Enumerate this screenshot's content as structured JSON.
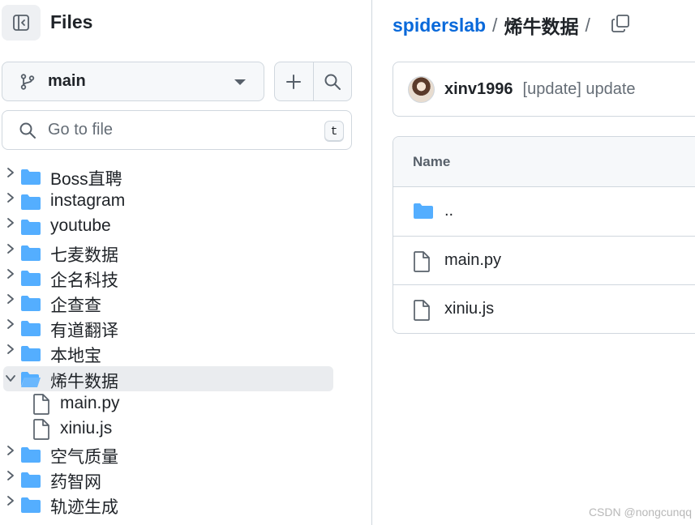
{
  "sidebar": {
    "title": "Files",
    "branch": "main",
    "search_placeholder": "Go to file",
    "shortcut_key": "t",
    "tree": [
      {
        "label": "Boss直聘",
        "type": "folder",
        "expanded": false
      },
      {
        "label": "instagram",
        "type": "folder",
        "expanded": false
      },
      {
        "label": "youtube",
        "type": "folder",
        "expanded": false
      },
      {
        "label": "七麦数据",
        "type": "folder",
        "expanded": false
      },
      {
        "label": "企名科技",
        "type": "folder",
        "expanded": false
      },
      {
        "label": "企查查",
        "type": "folder",
        "expanded": false
      },
      {
        "label": "有道翻译",
        "type": "folder",
        "expanded": false
      },
      {
        "label": "本地宝",
        "type": "folder",
        "expanded": false
      },
      {
        "label": "烯牛数据",
        "type": "folder",
        "expanded": true,
        "selected": true
      },
      {
        "label": "main.py",
        "type": "file",
        "child": true
      },
      {
        "label": "xiniu.js",
        "type": "file",
        "child": true
      },
      {
        "label": "空气质量",
        "type": "folder",
        "expanded": false
      },
      {
        "label": "药智网",
        "type": "folder",
        "expanded": false
      },
      {
        "label": "轨迹生成",
        "type": "folder",
        "expanded": false
      }
    ]
  },
  "main": {
    "breadcrumb": {
      "repo": "spiderslab",
      "separator": "/",
      "current": "烯牛数据",
      "trailing": "/"
    },
    "commit": {
      "author": "xinv1996",
      "message": "[update] update"
    },
    "table": {
      "header": "Name",
      "rows": [
        {
          "label": "..",
          "type": "parent-folder"
        },
        {
          "label": "main.py",
          "type": "file"
        },
        {
          "label": "xiniu.js",
          "type": "file"
        }
      ]
    }
  },
  "watermark": "CSDN @nongcunqq",
  "colors": {
    "folder": "#54aeff",
    "link": "#0969da",
    "border": "#d0d7de",
    "selected_bg": "#eaecef"
  }
}
